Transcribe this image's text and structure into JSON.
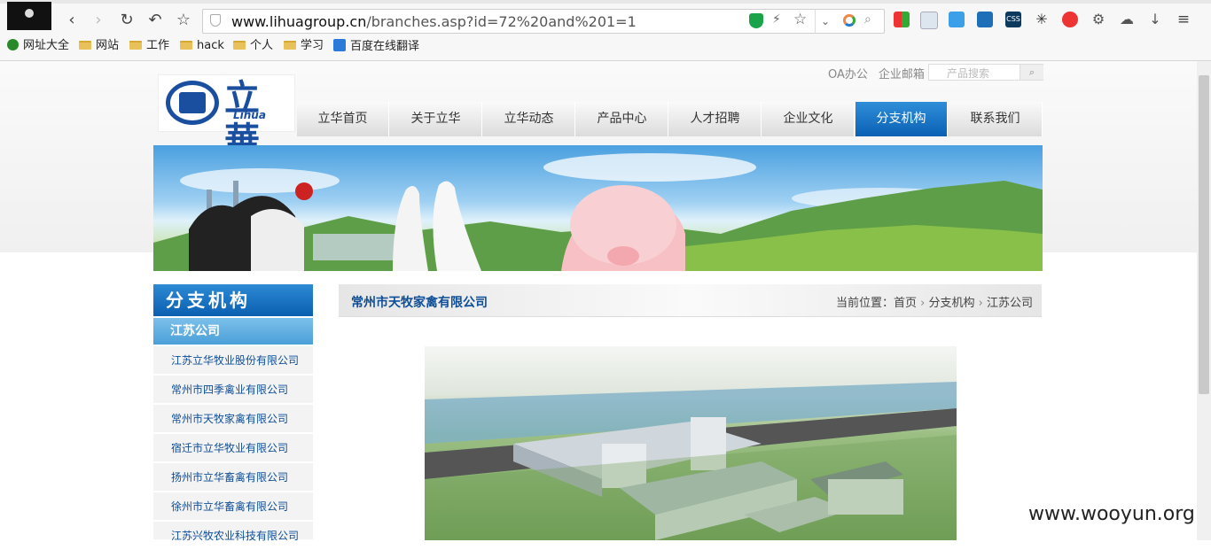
{
  "browser": {
    "url_domain": "www.lihuagroup.cn",
    "url_path": "/branches.asp?id=72%20and%201=1",
    "bookmarks": [
      {
        "label": "网址大全",
        "icon": "globe-icon"
      },
      {
        "label": "网站",
        "icon": "folder-icon"
      },
      {
        "label": "工作",
        "icon": "folder-icon"
      },
      {
        "label": "hack",
        "icon": "folder-icon"
      },
      {
        "label": "个人",
        "icon": "folder-icon"
      },
      {
        "label": "学习",
        "icon": "folder-icon"
      },
      {
        "label": "百度在线翻译",
        "icon": "translate-icon"
      }
    ]
  },
  "site": {
    "toplinks": [
      "OA办公",
      "企业邮箱"
    ],
    "search_placeholder": "产品搜索",
    "logo_cn": "立華",
    "logo_en": "Lihua",
    "nav": [
      "立华首页",
      "关于立华",
      "立华动态",
      "产品中心",
      "人才招聘",
      "企业文化",
      "分支机构",
      "联系我们"
    ],
    "active_nav_index": 6
  },
  "sidebar": {
    "heading": "分支机构",
    "subheading": "江苏公司",
    "items": [
      "江苏立华牧业股份有限公司",
      "常州市四季禽业有限公司",
      "常州市天牧家禽有限公司",
      "宿迁市立华牧业有限公司",
      "扬州市立华畜禽有限公司",
      "徐州市立华畜禽有限公司",
      "江苏兴牧农业科技有限公司"
    ]
  },
  "content": {
    "title": "常州市天牧家禽有限公司",
    "breadcrumb_label": "当前位置：",
    "breadcrumb": [
      "首页",
      "分支机构",
      "江苏公司"
    ]
  },
  "watermark": "www.wooyun.org",
  "colors": {
    "brand_blue": "#0b5fb0",
    "link_blue": "#0e4e96"
  }
}
